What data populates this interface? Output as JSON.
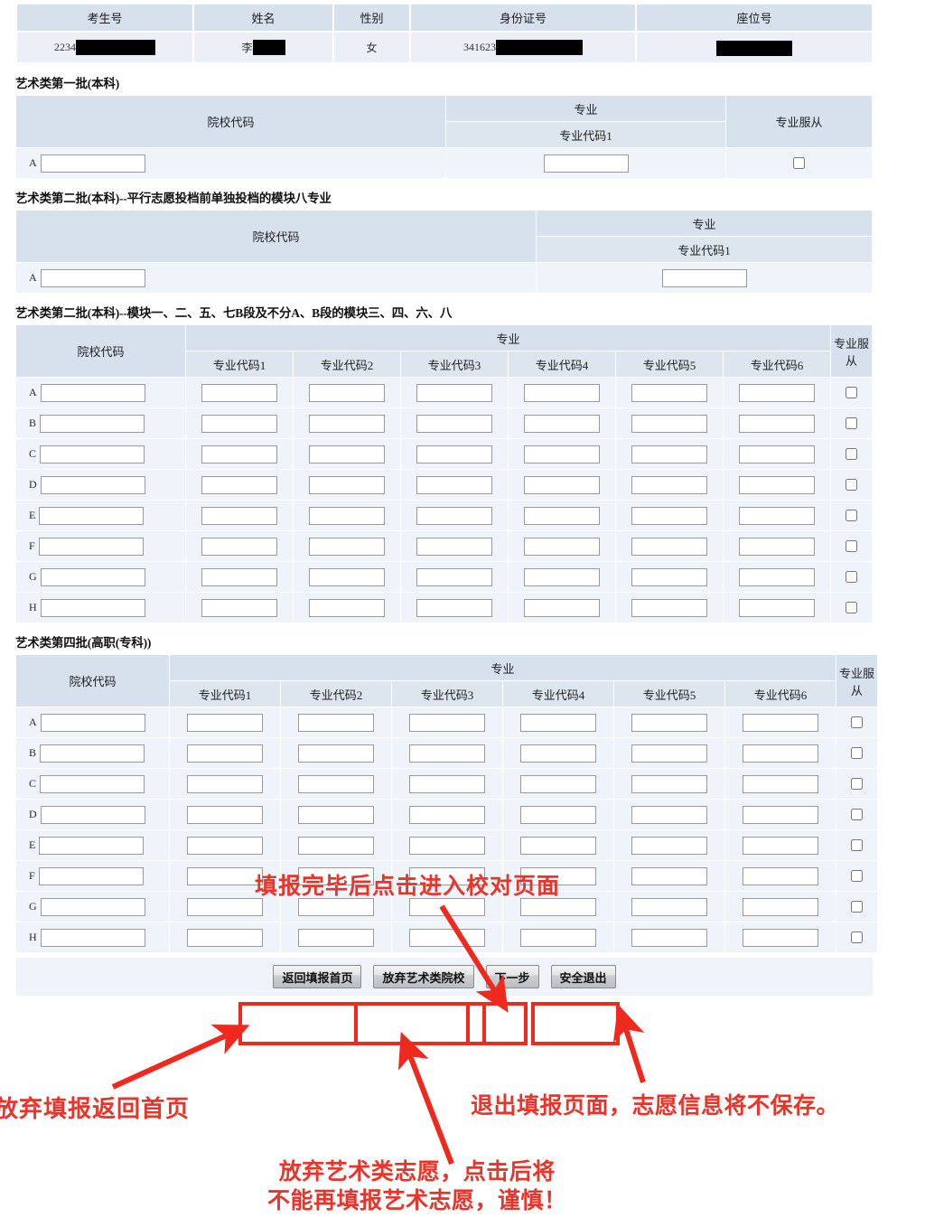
{
  "candidate_table": {
    "headers": [
      "考生号",
      "姓名",
      "性别",
      "身份证号",
      "座位号"
    ],
    "values": {
      "exam_no_prefix": "2234",
      "name_prefix": "李",
      "gender": "女",
      "id_prefix": "341623",
      "seat_prefix": ""
    }
  },
  "sections": [
    {
      "title": "艺术类第一批(本科)",
      "headers": {
        "school_code": "院校代码",
        "major_group": "专业",
        "major_codes": [
          "专业代码1"
        ],
        "obey": "专业服从"
      },
      "rows": [
        "A"
      ],
      "has_obey": true
    },
    {
      "title": "艺术类第二批(本科)--平行志愿投档前单独投档的模块八专业",
      "headers": {
        "school_code": "院校代码",
        "major_group": "专业",
        "major_codes": [
          "专业代码1"
        ],
        "obey": ""
      },
      "rows": [
        "A"
      ],
      "has_obey": false
    },
    {
      "title": "艺术类第二批(本科)--模块一、二、五、七B段及不分A、B段的模块三、四、六、八",
      "headers": {
        "school_code": "院校代码",
        "major_group": "专业",
        "major_codes": [
          "专业代码1",
          "专业代码2",
          "专业代码3",
          "专业代码4",
          "专业代码5",
          "专业代码6"
        ],
        "obey": "专业服从"
      },
      "rows": [
        "A",
        "B",
        "C",
        "D",
        "E",
        "F",
        "G",
        "H"
      ],
      "has_obey": true
    },
    {
      "title": "艺术类第四批(高职(专科))",
      "headers": {
        "school_code": "院校代码",
        "major_group": "专业",
        "major_codes": [
          "专业代码1",
          "专业代码2",
          "专业代码3",
          "专业代码4",
          "专业代码5",
          "专业代码6"
        ],
        "obey": "专业服从"
      },
      "rows": [
        "A",
        "B",
        "C",
        "D",
        "E",
        "F",
        "G",
        "H"
      ],
      "has_obey": true
    }
  ],
  "buttons": {
    "back_home": "返回填报首页",
    "give_up_art": "放弃艺术类院校",
    "next_step": "下一步",
    "safe_exit": "安全退出"
  },
  "annotations": {
    "top": "填报完毕后点击进入校对页面",
    "left": "放弃填报返回首页",
    "right": "退出填报页面，志愿信息将不保存。",
    "middle_line1": "放弃艺术类志愿，点击后将",
    "middle_line2": "不能再填报艺术志愿，谨慎！"
  },
  "colors": {
    "header_bg": "#dde5ef",
    "row_bg": "#eff3fa",
    "annotation_red": "#e8342a",
    "highlight_red": "#ee2a1f"
  }
}
